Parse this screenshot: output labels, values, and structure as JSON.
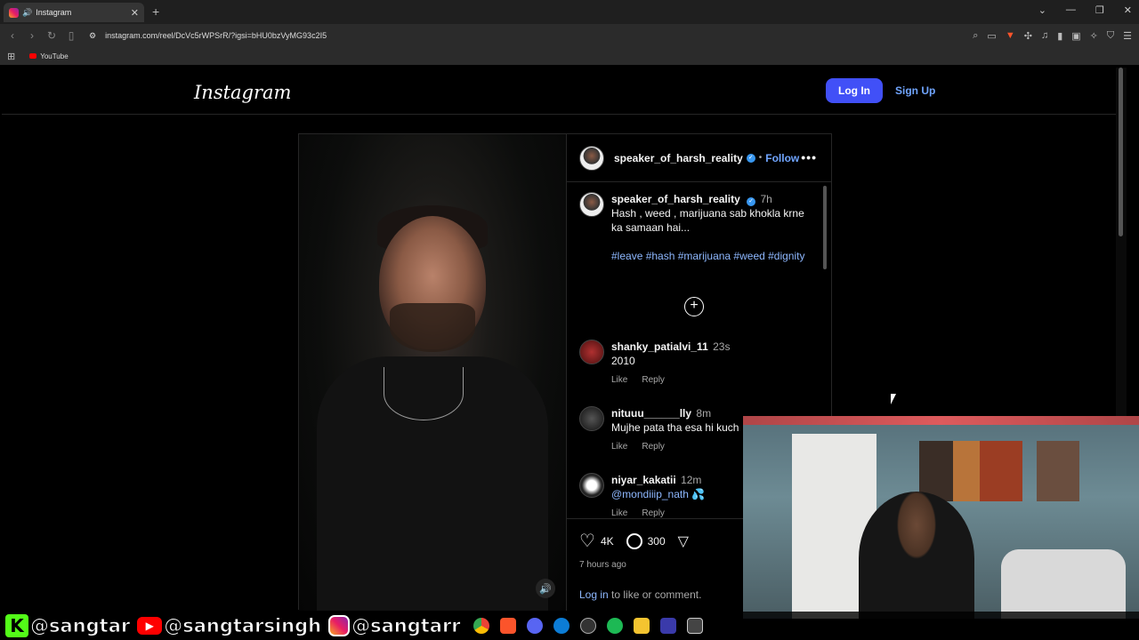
{
  "browser": {
    "tab_title": "Instagram",
    "url": "instagram.com/reel/DcVc5rWPSrR/?igsi=bHU0bzVyMG93c2I5",
    "bookmark_youtube": "YouTube"
  },
  "instagram": {
    "logo": "Instagram",
    "login_label": "Log In",
    "signup_label": "Sign Up"
  },
  "post": {
    "username": "speaker_of_harsh_reality",
    "follow_label": "Follow",
    "more_label": "•••",
    "caption": {
      "username": "speaker_of_harsh_reality",
      "time": "7h",
      "text": "Hash , weed , marijuana sab khokla krne ka samaan hai...",
      "tags": "#leave #hash #marijuana #weed #dignity"
    },
    "comments": [
      {
        "username": "shanky_patialvi_11",
        "time": "23s",
        "text": "2010",
        "like": "Like",
        "reply": "Reply"
      },
      {
        "username": "nituuu______lly",
        "time": "8m",
        "text": "Mujhe pata tha esa hi kuch",
        "like": "Like",
        "reply": "Reply"
      },
      {
        "username": "niyar_kakatii",
        "time": "12m",
        "text": "@mondiiip_nath",
        "emoji": "💦",
        "like": "Like",
        "reply": "Reply"
      }
    ],
    "likes": "4K",
    "comment_count": "300",
    "posted_ago": "7 hours ago",
    "login_link": "Log in",
    "login_suffix": " to like or comment."
  },
  "overlay": {
    "kick": "@sangtar",
    "youtube": "@sangtarsingh",
    "instagram": "@sangtarr"
  },
  "colors": {
    "accent": "#4150f7",
    "link": "#70a5ff",
    "kick": "#53fc18"
  }
}
